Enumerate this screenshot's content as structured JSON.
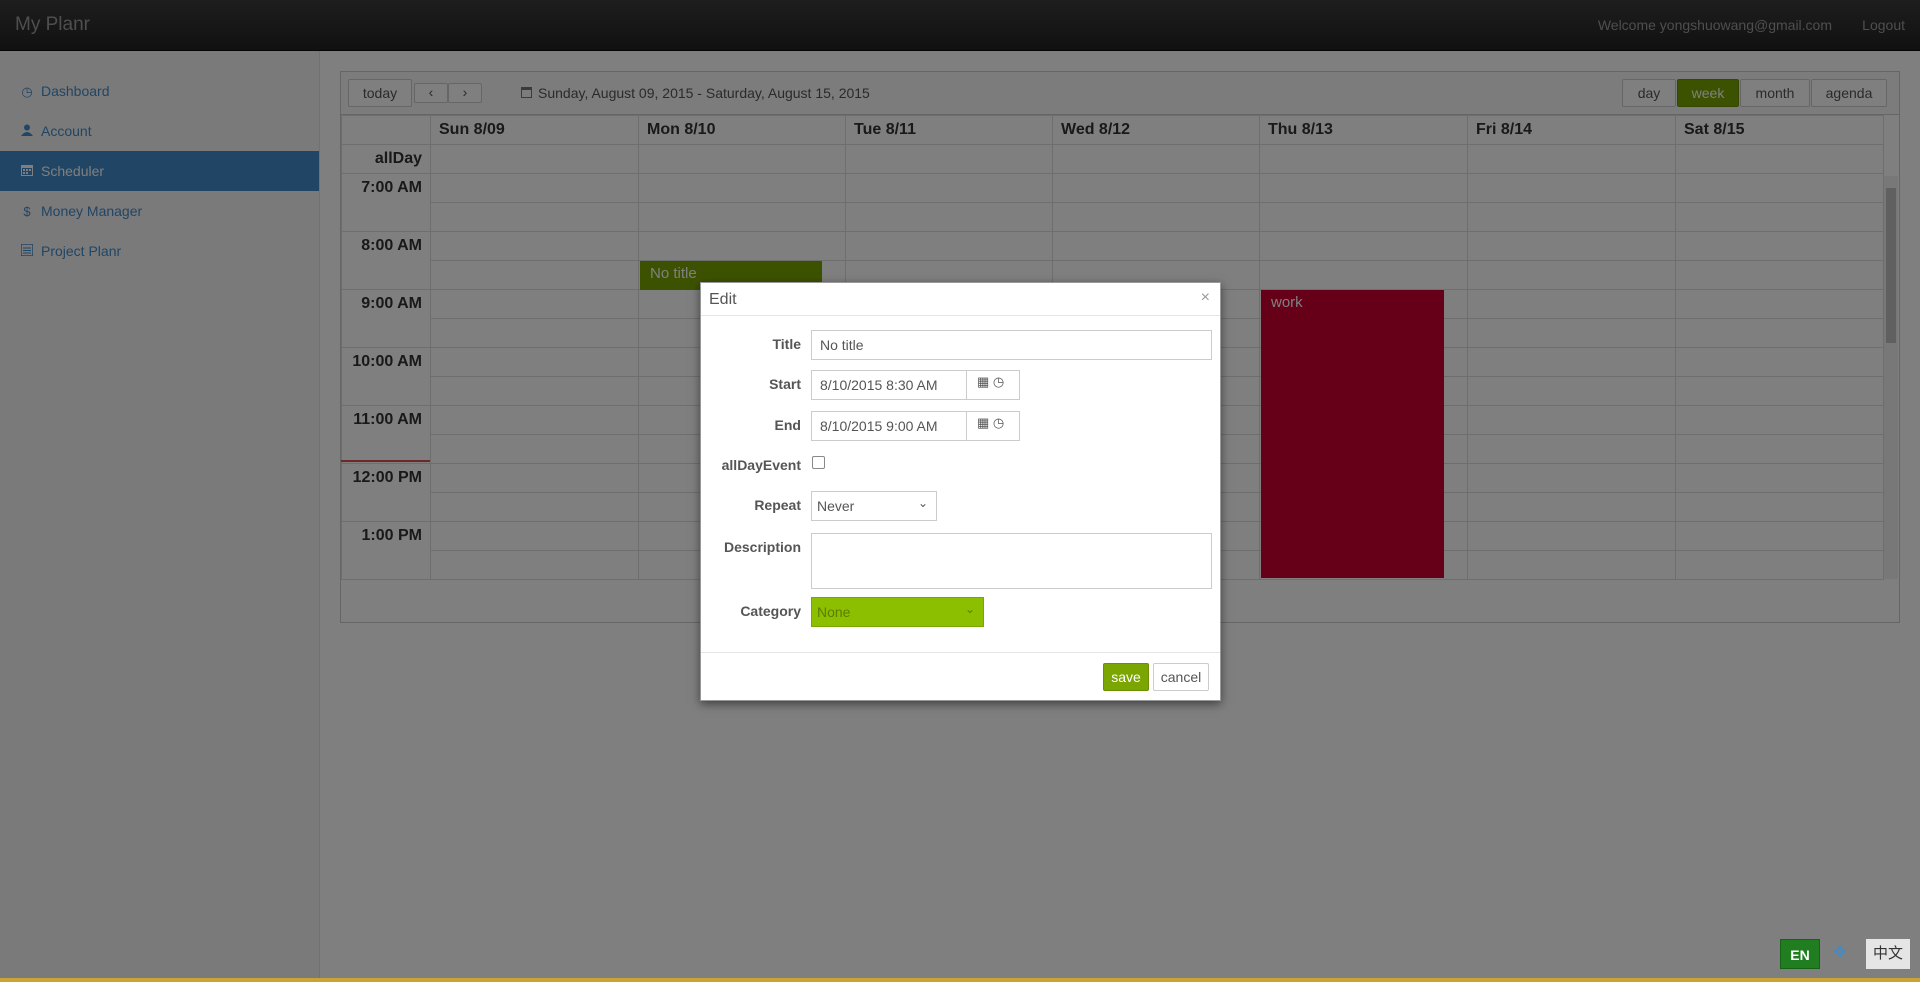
{
  "app": {
    "title": "My Planr",
    "welcome": "Welcome yongshuowang@gmail.com",
    "logout": "Logout"
  },
  "sidebar": {
    "items": [
      {
        "label": "Dashboard",
        "icon": "dashboard-icon",
        "active": false
      },
      {
        "label": "Account",
        "icon": "user-icon",
        "active": false
      },
      {
        "label": "Scheduler",
        "icon": "calendar-icon",
        "active": true
      },
      {
        "label": "Money Manager",
        "icon": "dollar-icon",
        "active": false
      },
      {
        "label": "Project Planr",
        "icon": "list-icon",
        "active": false
      }
    ]
  },
  "calendar": {
    "today_label": "today",
    "prev_icon": "chevron-left-icon",
    "next_icon": "chevron-right-icon",
    "range": "Sunday, August 09, 2015 - Saturday, August 15, 2015",
    "views": [
      "day",
      "week",
      "month",
      "agenda"
    ],
    "active_view": "week",
    "days": [
      "Sun 8/09",
      "Mon 8/10",
      "Tue 8/11",
      "Wed 8/12",
      "Thu 8/13",
      "Fri 8/14",
      "Sat 8/15"
    ],
    "allday_label": "allDay",
    "times": [
      "7:00 AM",
      "8:00 AM",
      "9:00 AM",
      "10:00 AM",
      "11:00 AM",
      "12:00 PM",
      "1:00 PM"
    ],
    "events": [
      {
        "title": "No title",
        "day": "Mon 8/10",
        "start": "8:30 AM",
        "end": "9:00 AM",
        "color": "#7ba500"
      },
      {
        "title": "work",
        "day": "Thu 8/13",
        "start": "9:00 AM",
        "end": "2:00 PM",
        "color": "#cc0033"
      }
    ]
  },
  "modal": {
    "title": "Edit",
    "close": "×",
    "fields": {
      "title_label": "Title",
      "title_value": "No title",
      "start_label": "Start",
      "start_value": "8/10/2015 8:30 AM",
      "end_label": "End",
      "end_value": "8/10/2015 9:00 AM",
      "allday_label": "allDayEvent",
      "allday_checked": false,
      "repeat_label": "Repeat",
      "repeat_value": "Never",
      "description_label": "Description",
      "description_value": "",
      "category_label": "Category",
      "category_value": "None"
    },
    "save": "save",
    "cancel": "cancel"
  },
  "language": {
    "en": "EN",
    "zh": "中文"
  },
  "colors": {
    "accent": "#7ba500",
    "primary": "#428bca",
    "work": "#cc0033"
  }
}
